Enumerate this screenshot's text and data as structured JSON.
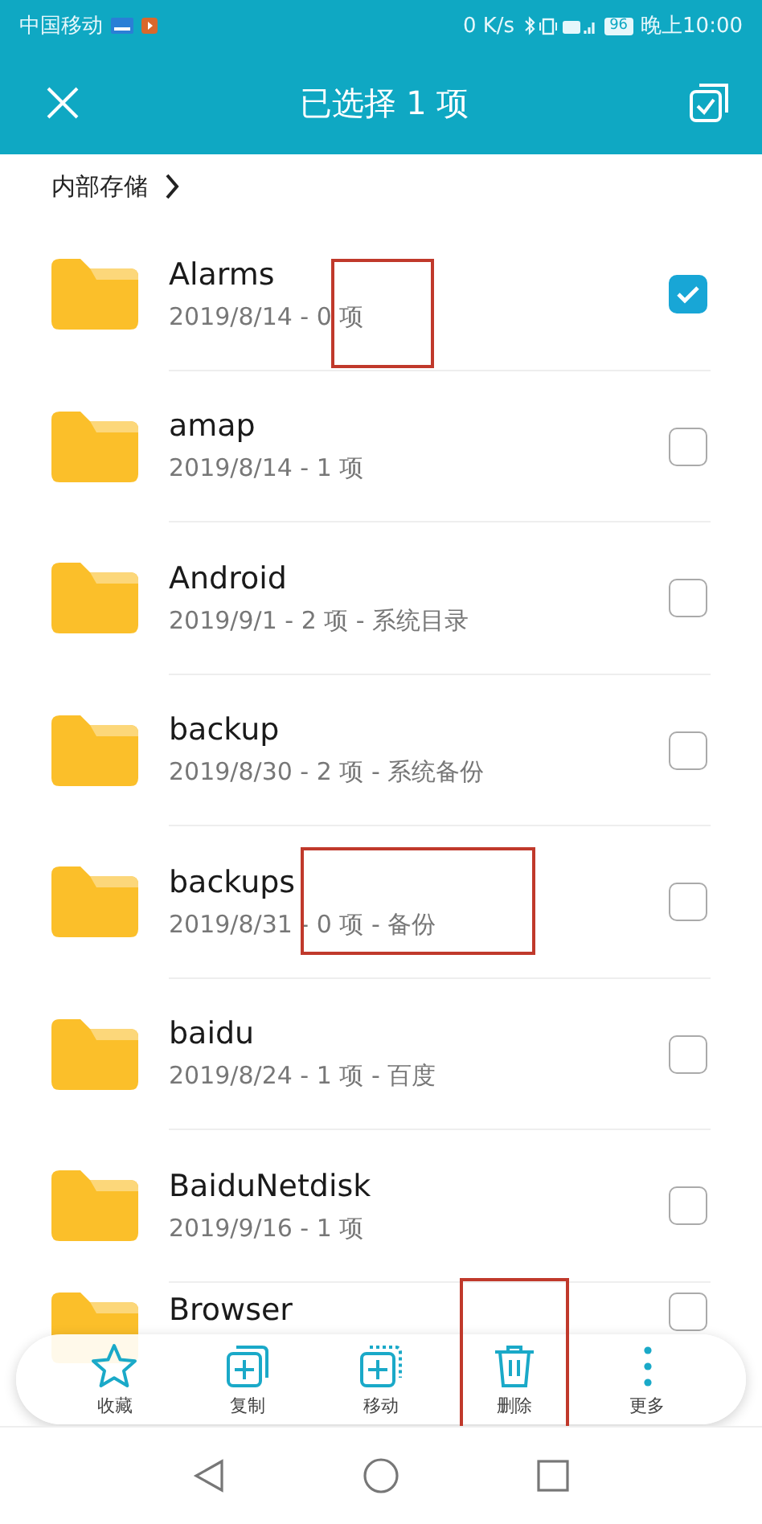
{
  "status_bar": {
    "carrier": "中国移动",
    "speed": "0 K/s",
    "battery": "96",
    "time": "晚上10:00"
  },
  "app_bar": {
    "title": "已选择 1 项"
  },
  "breadcrumb": {
    "label": "内部存储"
  },
  "rows": [
    {
      "name": "Alarms",
      "info": "2019/8/14 - 0 项",
      "checked": true,
      "highlighted": true
    },
    {
      "name": "amap",
      "info": "2019/8/14 - 1 项",
      "checked": false,
      "highlighted": false
    },
    {
      "name": "Android",
      "info": "2019/9/1 - 2 项 - 系统目录",
      "checked": false,
      "highlighted": false
    },
    {
      "name": "backup",
      "info": "2019/8/30 - 2 项 - 系统备份",
      "checked": false,
      "highlighted": false
    },
    {
      "name": "backups",
      "info": "2019/8/31 - 0 项 - 备份",
      "checked": false,
      "highlighted": true
    },
    {
      "name": "baidu",
      "info": "2019/8/24 - 1 项 - 百度",
      "checked": false,
      "highlighted": false
    },
    {
      "name": "BaiduNetdisk",
      "info": "2019/9/16 - 1 项",
      "checked": false,
      "highlighted": false
    },
    {
      "name": "Browser",
      "checked": false,
      "highlighted": false
    }
  ],
  "toolbar": [
    {
      "kind": "star",
      "label": "收藏",
      "highlighted": false
    },
    {
      "kind": "copy",
      "label": "复制",
      "highlighted": false
    },
    {
      "kind": "move",
      "label": "移动",
      "highlighted": false
    },
    {
      "kind": "delete",
      "label": "删除",
      "highlighted": true
    },
    {
      "kind": "more",
      "label": "更多",
      "highlighted": false
    }
  ]
}
